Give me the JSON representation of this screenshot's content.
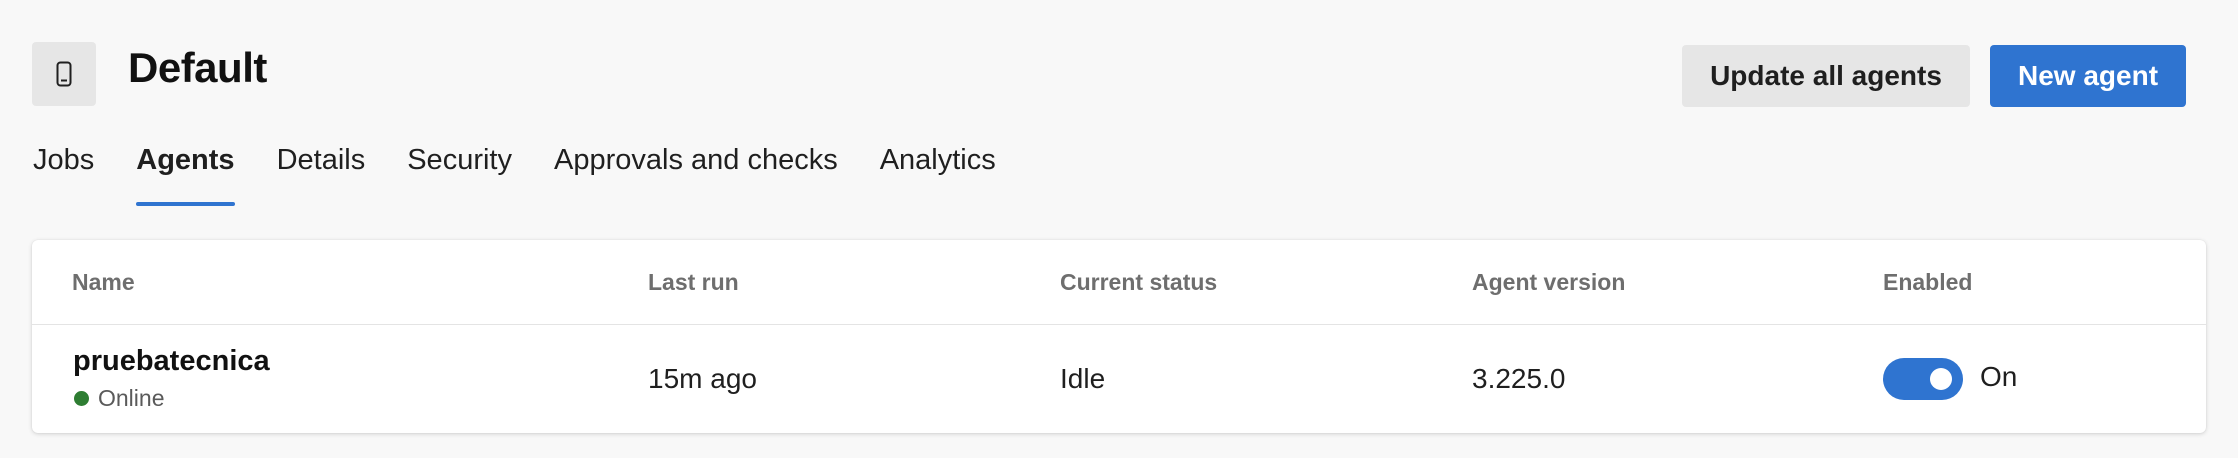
{
  "header": {
    "title": "Default",
    "icon": "phone-device-icon",
    "update_all_label": "Update all agents",
    "new_agent_label": "New agent"
  },
  "tabs": [
    {
      "label": "Jobs",
      "active": false
    },
    {
      "label": "Agents",
      "active": true
    },
    {
      "label": "Details",
      "active": false
    },
    {
      "label": "Security",
      "active": false
    },
    {
      "label": "Approvals and checks",
      "active": false
    },
    {
      "label": "Analytics",
      "active": false
    }
  ],
  "table": {
    "columns": [
      "Name",
      "Last run",
      "Current status",
      "Agent version",
      "Enabled"
    ],
    "rows": [
      {
        "name": "pruebatecnica",
        "online_status": "Online",
        "last_run": "15m ago",
        "current_status": "Idle",
        "agent_version": "3.225.0",
        "enabled": true,
        "enabled_label": "On"
      }
    ]
  },
  "colors": {
    "accent": "#2f74d0",
    "online": "#2e7d32",
    "background": "#f8f8f8"
  }
}
